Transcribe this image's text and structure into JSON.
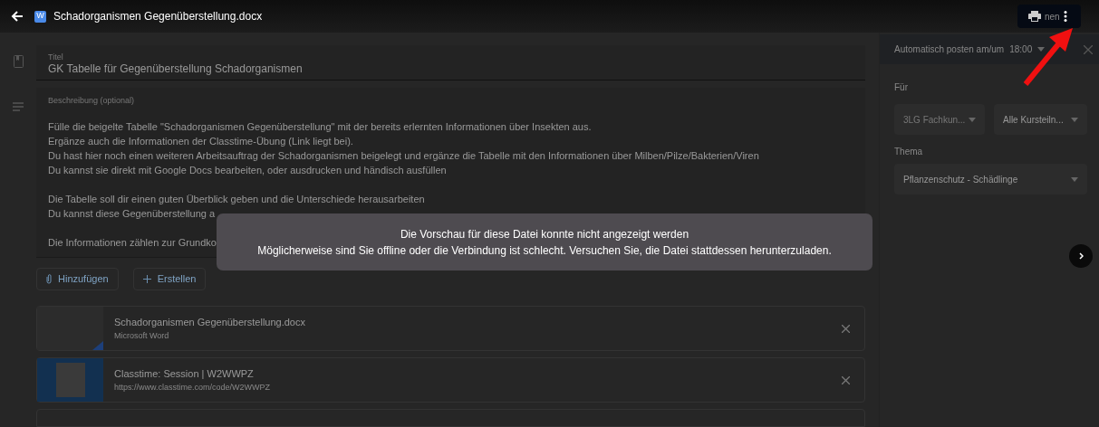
{
  "header": {
    "title": "Schadorganismen Gegenüberstellung.docx",
    "file_badge": "W",
    "action_text": "nen"
  },
  "title_field": {
    "label": "Titel",
    "value": "GK Tabelle für Gegenüberstellung Schadorganismen"
  },
  "description_field": {
    "label": "Beschreibung (optional)",
    "paragraphs": [
      [
        "Fülle die beigelte Tabelle \"Schadorganismen Gegenüberstellung\" mit der bereits erlernten Informationen über Insekten aus.",
        "Ergänze auch die Informationen der Classtime-Übung (Link liegt bei).",
        "Du hast hier noch einen weiteren Arbeitsauftrag der Schadorganismen beigelegt und ergänze die Tabelle mit den Informationen über Milben/Pilze/Bakterien/Viren",
        "Du kannst sie direkt mit Google Docs bearbeiten, oder ausdrucken und händisch ausfüllen"
      ],
      [
        "Die Tabelle soll dir einen guten Überblick geben und die Unterschiede herausarbeiten",
        "Du kannst diese Gegenüberstellung a"
      ],
      [
        "Die Informationen zählen zur Grundko"
      ]
    ]
  },
  "buttons": [
    {
      "kind": "attach",
      "label": "Hinzufügen"
    },
    {
      "kind": "create",
      "label": "Erstellen"
    }
  ],
  "attachments": [
    {
      "kind": "doc",
      "name": "Schadorganismen Gegenüberstellung.docx",
      "subtitle": "Microsoft Word"
    },
    {
      "kind": "link",
      "name": "Classtime: Session | W2WWPZ",
      "subtitle": "https://www.classtime.com/code/W2WWPZ"
    }
  ],
  "side_panel": {
    "schedule": "Automatisch posten am/um",
    "time": "18:00",
    "for_label": "Für",
    "class_select": "3LG Fachkun...",
    "students_select": "Alle Kursteiln...",
    "topic_label": "Thema",
    "topic_select": "Pflanzenschutz - Schädlinge"
  },
  "preview_error": {
    "lines": [
      "Die Vorschau für diese Datei konnte nicht angezeigt werden",
      "Möglicherweise sind Sie offline oder die Verbindung ist schlecht. Versuchen Sie, die Datei stattdessen herunterzuladen."
    ]
  }
}
